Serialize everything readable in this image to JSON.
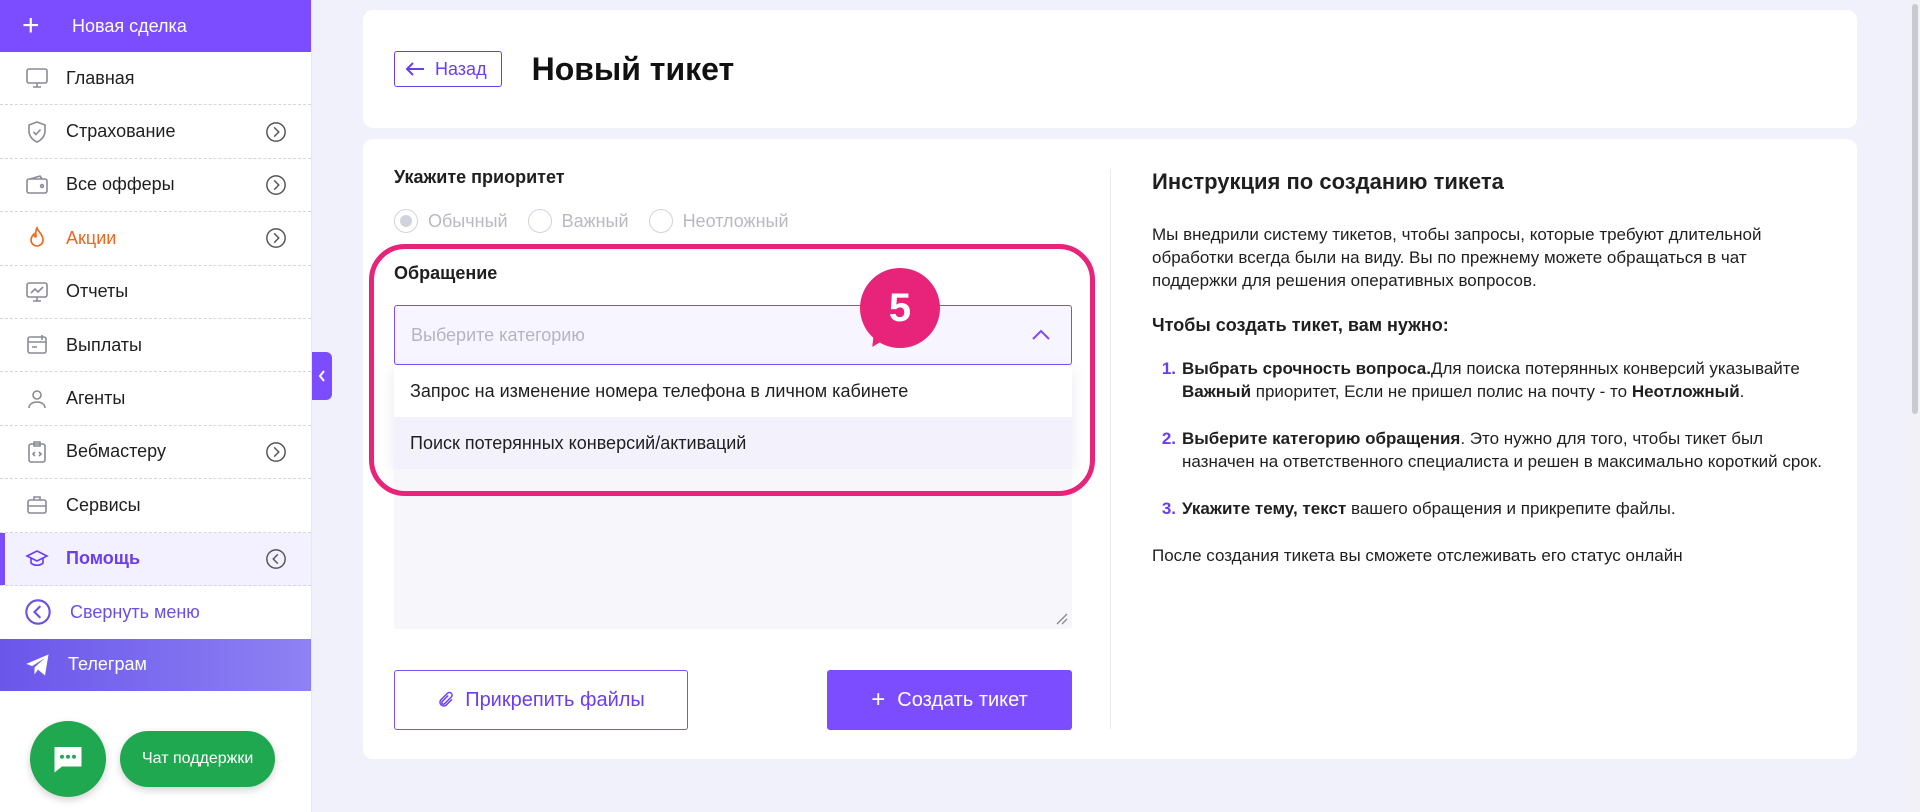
{
  "sidebar": {
    "new_deal": "Новая сделка",
    "items": [
      {
        "label": "Главная",
        "icon": "monitor-icon",
        "chevron": false
      },
      {
        "label": "Страхование",
        "icon": "shield-icon",
        "chevron": true
      },
      {
        "label": "Все офферы",
        "icon": "wallet-icon",
        "chevron": true
      },
      {
        "label": "Акции",
        "icon": "flame-icon",
        "chevron": true
      },
      {
        "label": "Отчеты",
        "icon": "chart-monitor-icon",
        "chevron": false
      },
      {
        "label": "Выплаты",
        "icon": "payout-icon",
        "chevron": false
      },
      {
        "label": "Агенты",
        "icon": "user-icon",
        "chevron": false
      },
      {
        "label": "Вебмастеру",
        "icon": "clipboard-code-icon",
        "chevron": true
      },
      {
        "label": "Сервисы",
        "icon": "briefcase-icon",
        "chevron": false
      },
      {
        "label": "Помощь",
        "icon": "graduation-cap-icon",
        "chevron": true
      }
    ],
    "collapse_label": "Свернуть меню",
    "telegram_label": "Телеграм",
    "support_label": "Чат поддержки"
  },
  "header": {
    "back_label": "Назад",
    "title": "Новый тикет"
  },
  "form": {
    "priority_label": "Укажите приоритет",
    "priorities": [
      "Обычный",
      "Важный",
      "Неотложный"
    ],
    "appeal_label": "Обращение",
    "category_placeholder": "Выберите категорию",
    "category_options": [
      "Запрос на изменение номера телефона в личном кабинете",
      "Поиск потерянных конверсий/активаций"
    ],
    "attach_label": "Прикрепить файлы",
    "create_label": "Создать тикет"
  },
  "tour": {
    "step": "5",
    "color": "#e8237a"
  },
  "instructions": {
    "title": "Инструкция по созданию тикета",
    "intro": "Мы внедрили систему тикетов, чтобы запросы, которые требуют длительной обработки всегда были на виду. Вы по прежнему можете обращаться в чат поддержки для решения оперативных вопросов.",
    "subtitle": "Чтобы создать тикет, вам нужно:",
    "steps": [
      {
        "num": "1.",
        "bold": "Выбрать срочность вопроса.",
        "text": "Для поиска потерянных конверсий указывайте ",
        "bold2": "Важный",
        "text2": " приоритет, Если не пришел полис на почту - то ",
        "bold3": "Неотложный",
        "text3": "."
      },
      {
        "num": "2.",
        "bold": "Выберите категорию обращения",
        "text": ". Это нужно для того, чтобы тикет был назначен на ответственного специалиста и решен в максимально короткий срок."
      },
      {
        "num": "3.",
        "bold": "Укажите тему, текст",
        "text": " вашего обращения и прикрепите файлы."
      }
    ],
    "outro": "После создания тикета вы сможете отслеживать его статус онлайн"
  },
  "colors": {
    "accent": "#7c4dff",
    "support": "#1fa84f",
    "promo": "#f1661c"
  }
}
